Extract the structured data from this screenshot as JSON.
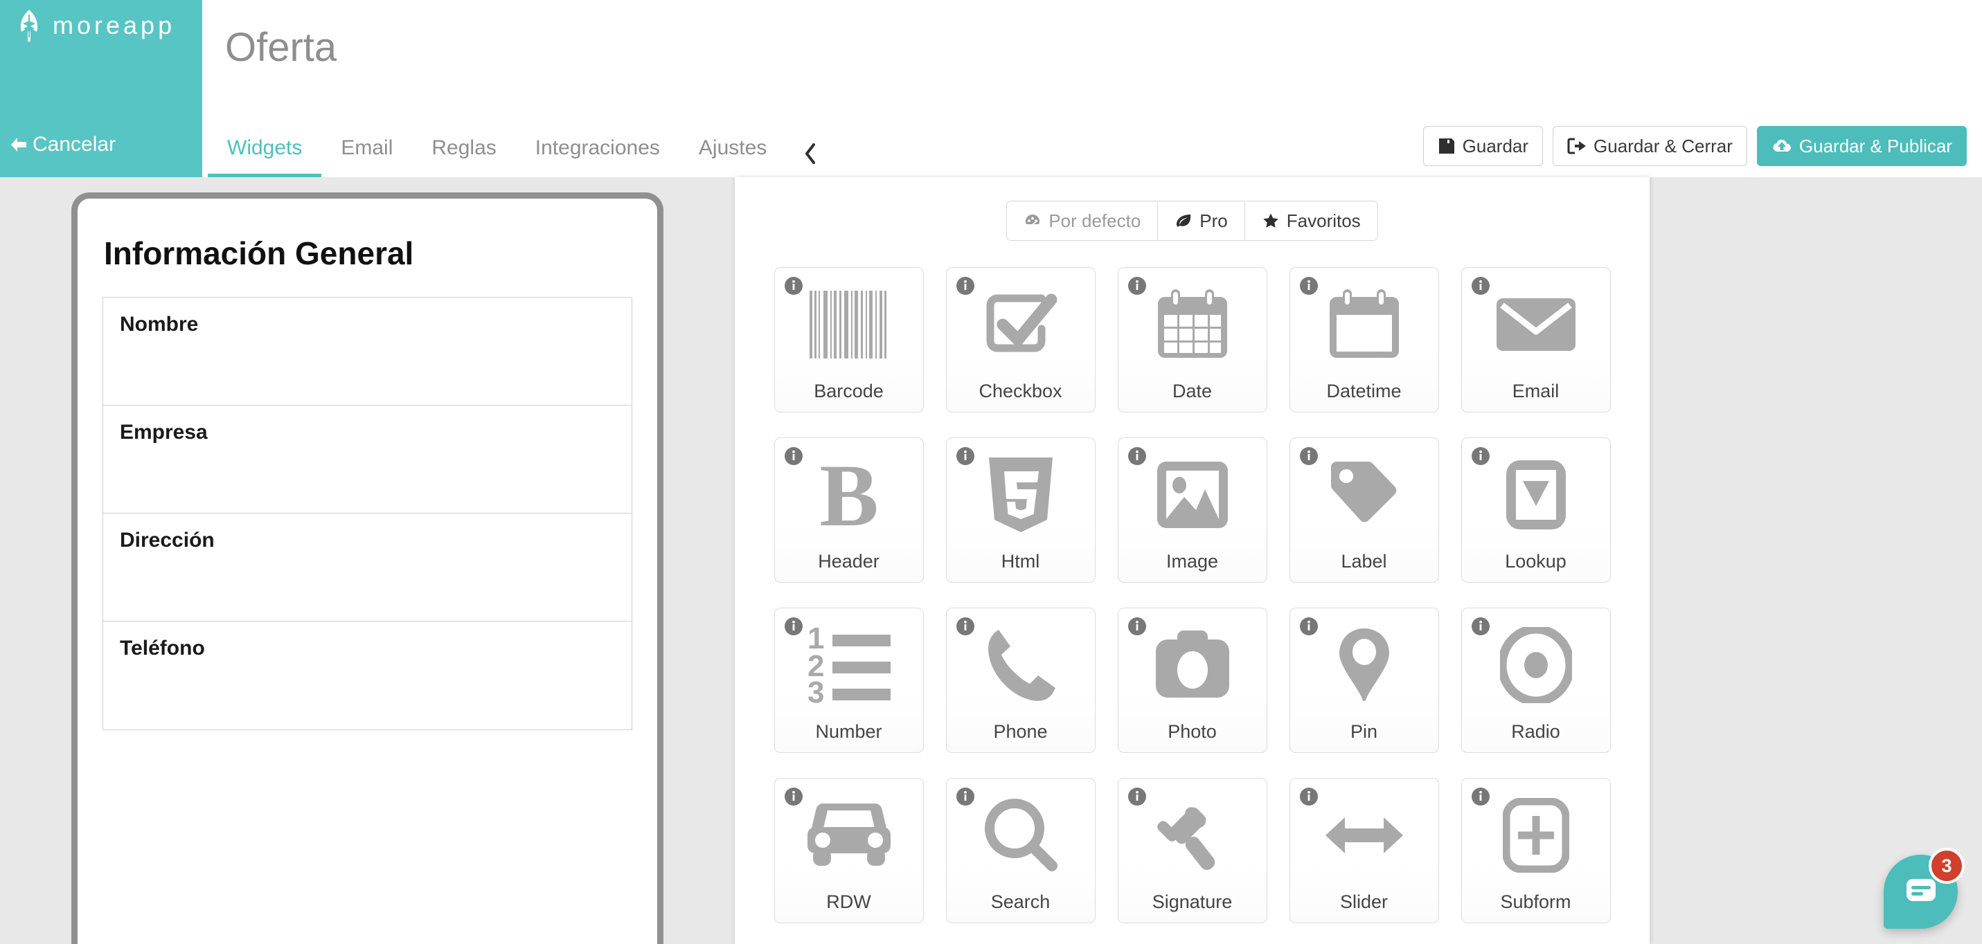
{
  "brand": {
    "name": "moreapp",
    "logo_icon": "leaf-icon",
    "color": "#57c5c3",
    "cancel_label": "Cancelar",
    "cancel_icon": "arrow-left-icon"
  },
  "header": {
    "title": "Oferta"
  },
  "tabs": [
    {
      "label": "Widgets",
      "active": true
    },
    {
      "label": "Email",
      "active": false
    },
    {
      "label": "Reglas",
      "active": false
    },
    {
      "label": "Integraciones",
      "active": false
    },
    {
      "label": "Ajustes",
      "active": false
    }
  ],
  "tab_collapse_icon": "chevron-left-icon",
  "actions": [
    {
      "label": "Guardar",
      "icon": "save-floppy-icon",
      "primary": false
    },
    {
      "label": "Guardar & Cerrar",
      "icon": "sign-out-icon",
      "primary": false
    },
    {
      "label": "Guardar & Publicar",
      "icon": "cloud-upload-icon",
      "primary": true
    }
  ],
  "preview": {
    "form_title": "Información General",
    "fields": [
      {
        "label": "Nombre"
      },
      {
        "label": "Empresa"
      },
      {
        "label": "Dirección"
      },
      {
        "label": "Teléfono"
      }
    ]
  },
  "widget_panel": {
    "filters": [
      {
        "label": "Por defecto",
        "icon": "dashboard-icon",
        "active": false
      },
      {
        "label": "Pro",
        "icon": "leaf-icon",
        "active": true
      },
      {
        "label": "Favoritos",
        "icon": "star-icon",
        "active": false
      }
    ],
    "info_icon": "info-circle-icon",
    "widgets": [
      {
        "label": "Barcode",
        "icon": "barcode-icon"
      },
      {
        "label": "Checkbox",
        "icon": "checkbox-icon"
      },
      {
        "label": "Date",
        "icon": "calendar-grid-icon"
      },
      {
        "label": "Datetime",
        "icon": "calendar-blank-icon"
      },
      {
        "label": "Email",
        "icon": "envelope-icon"
      },
      {
        "label": "Header",
        "icon": "bold-b-icon"
      },
      {
        "label": "Html",
        "icon": "html5-shield-icon"
      },
      {
        "label": "Image",
        "icon": "picture-icon"
      },
      {
        "label": "Label",
        "icon": "price-tag-icon"
      },
      {
        "label": "Lookup",
        "icon": "dropdown-box-icon"
      },
      {
        "label": "Number",
        "icon": "ordered-list-icon"
      },
      {
        "label": "Phone",
        "icon": "phone-handset-icon"
      },
      {
        "label": "Photo",
        "icon": "camera-icon"
      },
      {
        "label": "Pin",
        "icon": "map-pin-icon"
      },
      {
        "label": "Radio",
        "icon": "radio-circle-icon"
      },
      {
        "label": "RDW",
        "icon": "car-icon"
      },
      {
        "label": "Search",
        "icon": "magnifier-icon"
      },
      {
        "label": "Signature",
        "icon": "gavel-icon"
      },
      {
        "label": "Slider",
        "icon": "arrows-horizontal-icon"
      },
      {
        "label": "Subform",
        "icon": "plus-box-icon"
      }
    ]
  },
  "chat": {
    "icon": "chat-bubble-icon",
    "badge_count": "3",
    "badge_color": "#d0402c"
  }
}
